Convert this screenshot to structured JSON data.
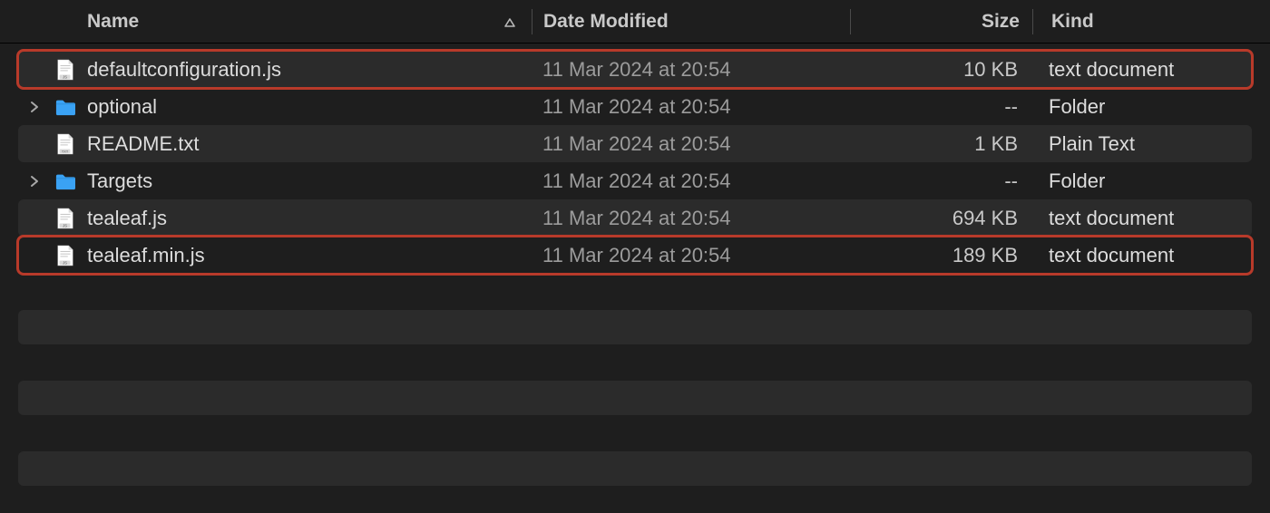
{
  "columns": {
    "name": "Name",
    "date": "Date Modified",
    "size": "Size",
    "kind": "Kind"
  },
  "rows": [
    {
      "name": "defaultconfiguration.js",
      "date": "11 Mar 2024 at 20:54",
      "size": "10 KB",
      "kind": "text document",
      "icon": "js-file",
      "expandable": false,
      "zebra": true,
      "highlight": true
    },
    {
      "name": "optional",
      "date": "11 Mar 2024 at 20:54",
      "size": "--",
      "kind": "Folder",
      "icon": "folder",
      "expandable": true,
      "zebra": false,
      "highlight": false
    },
    {
      "name": "README.txt",
      "date": "11 Mar 2024 at 20:54",
      "size": "1 KB",
      "kind": "Plain Text",
      "icon": "txt-file",
      "expandable": false,
      "zebra": true,
      "highlight": false
    },
    {
      "name": "Targets",
      "date": "11 Mar 2024 at 20:54",
      "size": "--",
      "kind": "Folder",
      "icon": "folder",
      "expandable": true,
      "zebra": false,
      "highlight": false
    },
    {
      "name": "tealeaf.js",
      "date": "11 Mar 2024 at 20:54",
      "size": "694 KB",
      "kind": "text document",
      "icon": "js-file",
      "expandable": false,
      "zebra": true,
      "highlight": false
    },
    {
      "name": "tealeaf.min.js",
      "date": "11 Mar 2024 at 20:54",
      "size": "189 KB",
      "kind": "text document",
      "icon": "js-file",
      "expandable": false,
      "zebra": false,
      "highlight": true
    }
  ]
}
